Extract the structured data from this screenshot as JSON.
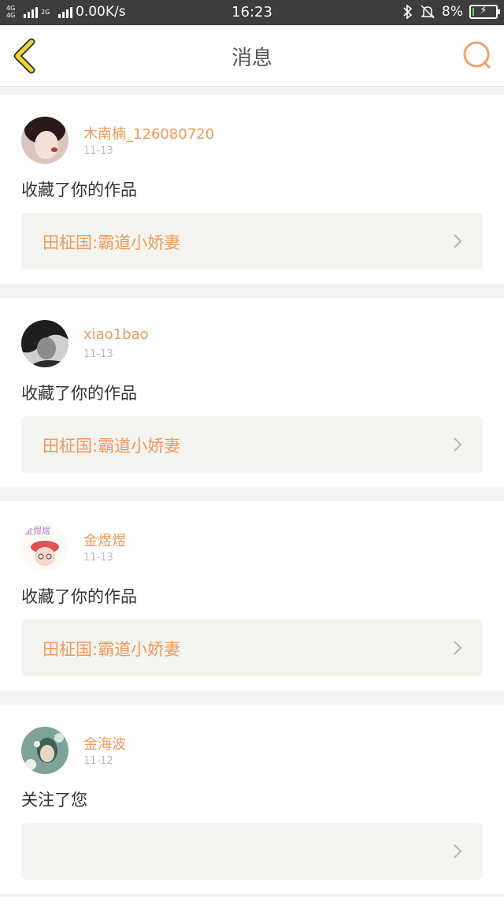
{
  "status_bar": {
    "net_tag": "4G 4G",
    "net_tag2": "2G",
    "speed": "0.00K/s",
    "time": "16:23",
    "battery": "8%",
    "battery_level": 0.08
  },
  "header": {
    "title": "消息",
    "back_icon": "back-chevron-icon",
    "search_icon": "search-icon"
  },
  "colors": {
    "accent": "#ef9a5f",
    "back_icon": "#f2d630",
    "card_box_bg": "#f4f4ef",
    "page_bg": "#f3f3f1"
  },
  "messages": [
    {
      "username": "木南楠_126080720",
      "date": "11-13",
      "action": "收藏了你的作品",
      "work": "田柾国:霸道小娇妻"
    },
    {
      "username": "xiao1bao",
      "date": "11-13",
      "action": "收藏了你的作品",
      "work": "田柾国:霸道小娇妻"
    },
    {
      "username": "金煜煜",
      "date": "11-13",
      "action": "收藏了你的作品",
      "work": "田柾国:霸道小娇妻",
      "avatar_text": "金煜煜"
    },
    {
      "username": "金海波",
      "date": "11-12",
      "action": "关注了您",
      "work": ""
    }
  ]
}
